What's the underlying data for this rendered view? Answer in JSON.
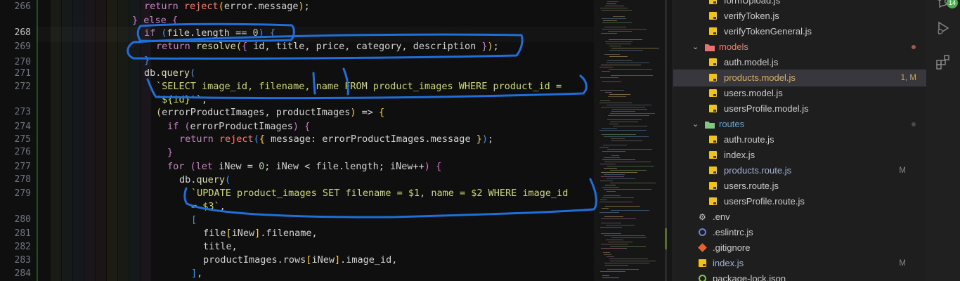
{
  "editor": {
    "lines": [
      {
        "num": "266",
        "text": "return reject(error.message);"
      },
      {
        "num": "",
        "text": "} else {"
      },
      {
        "num": "268",
        "text": "if (file.length == 0) {"
      },
      {
        "num": "269",
        "text": "return resolve({ id, title, price, category, description });"
      },
      {
        "num": "270",
        "text": "}"
      },
      {
        "num": "271",
        "text": "db.query("
      },
      {
        "num": "272",
        "text": "`SELECT image_id, filename, name FROM product_images WHERE product_id ="
      },
      {
        "num": "",
        "text": "'${id}'`,"
      },
      {
        "num": "273",
        "text": "(errorProductImages, productImages) => {"
      },
      {
        "num": "274",
        "text": "if (errorProductImages) {"
      },
      {
        "num": "275",
        "text": "return reject({ message: errorProductImages.message });"
      },
      {
        "num": "276",
        "text": "}"
      },
      {
        "num": "277",
        "text": "for (let iNew = 0; iNew < file.length; iNew++) {"
      },
      {
        "num": "278",
        "text": "db.query("
      },
      {
        "num": "279",
        "text": "`UPDATE product_images SET filename = $1, name = $2 WHERE image_id"
      },
      {
        "num": "",
        "text": "= $3`,"
      },
      {
        "num": "280",
        "text": "["
      },
      {
        "num": "281",
        "text": "file[iNew].filename,"
      },
      {
        "num": "282",
        "text": "title,"
      },
      {
        "num": "283",
        "text": "productImages.rows[iNew].image_id,"
      },
      {
        "num": "284",
        "text": "],"
      }
    ]
  },
  "explorer": {
    "items": [
      {
        "label": "formUpload.js",
        "type": "js"
      },
      {
        "label": "verifyToken.js",
        "type": "js"
      },
      {
        "label": "verifyTokenGeneral.js",
        "type": "js"
      },
      {
        "label": "models",
        "type": "folder"
      },
      {
        "label": "auth.model.js",
        "type": "js"
      },
      {
        "label": "products.model.js",
        "type": "js",
        "badge": "1, M",
        "selected": true
      },
      {
        "label": "users.model.js",
        "type": "js"
      },
      {
        "label": "usersProfile.model.js",
        "type": "js"
      },
      {
        "label": "routes",
        "type": "folder"
      },
      {
        "label": "auth.route.js",
        "type": "js"
      },
      {
        "label": "index.js",
        "type": "js"
      },
      {
        "label": "products.route.js",
        "type": "js",
        "badge": "M"
      },
      {
        "label": "users.route.js",
        "type": "js"
      },
      {
        "label": "usersProfile.route.js",
        "type": "js"
      },
      {
        "label": ".env",
        "type": "env"
      },
      {
        "label": ".eslintrc.js",
        "type": "eslint"
      },
      {
        "label": ".gitignore",
        "type": "git"
      },
      {
        "label": "index.js",
        "type": "js",
        "badge": "M"
      },
      {
        "label": "package-lock.json",
        "type": "json"
      }
    ]
  },
  "activity": {
    "badge_count": "14",
    "icons": [
      "source-control-icon",
      "run-debug-icon",
      "extensions-icon"
    ]
  },
  "colors": {
    "editor_bg": "#0f0f0f",
    "annotation": "#1e6fd9",
    "js_icon": "#f1c40f",
    "modified": "#c9a75b",
    "models_folder": "#e57373",
    "routes_folder": "#81c784"
  }
}
